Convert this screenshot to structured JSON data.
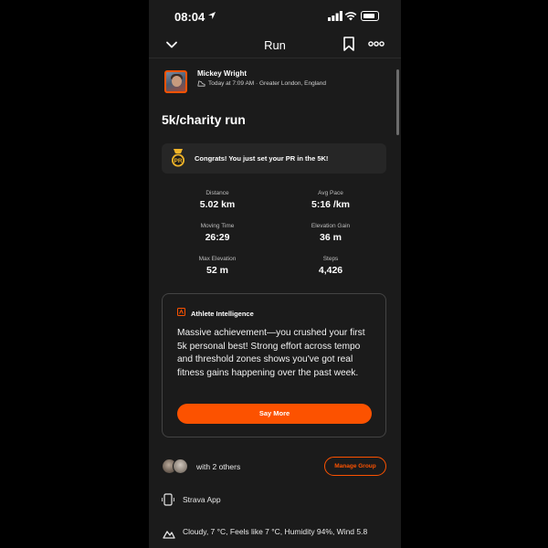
{
  "status_bar": {
    "time": "08:04"
  },
  "nav": {
    "title": "Run"
  },
  "athlete": {
    "name": "Mickey Wright",
    "meta": "Today at 7:09 AM · Greater London, England"
  },
  "activity": {
    "title": "5k/charity run"
  },
  "pr_banner": {
    "text": "Congrats! You just set your PR in the 5K!"
  },
  "stats": [
    {
      "label": "Distance",
      "value": "5.02 km"
    },
    {
      "label": "Avg Pace",
      "value": "5:16 /km"
    },
    {
      "label": "Moving Time",
      "value": "26:29"
    },
    {
      "label": "Elevation Gain",
      "value": "36 m"
    },
    {
      "label": "Max Elevation",
      "value": "52 m"
    },
    {
      "label": "Steps",
      "value": "4,426"
    }
  ],
  "athlete_intelligence": {
    "heading": "Athlete Intelligence",
    "body": "Massive achievement—you crushed your first 5k personal best! Strong effort across tempo and threshold zones shows you've got real fitness gains happening over the past week.",
    "button": "Say More"
  },
  "group": {
    "text": "with 2 others",
    "button": "Manage Group"
  },
  "device": {
    "text": "Strava App"
  },
  "weather": {
    "text": "Cloudy, 7 °C, Feels like 7 °C, Humidity 94%, Wind 5.8"
  },
  "colors": {
    "accent": "#fc5200",
    "background": "#1b1b1b",
    "card": "#262626"
  },
  "icons": {
    "back": "chevron-down-icon",
    "bookmark": "bookmark-icon",
    "more": "more-icon",
    "location": "location-arrow-icon",
    "medal": "pr-medal-icon",
    "ai": "athlete-intelligence-icon",
    "device": "phone-icon",
    "weather": "cloud-icon"
  }
}
